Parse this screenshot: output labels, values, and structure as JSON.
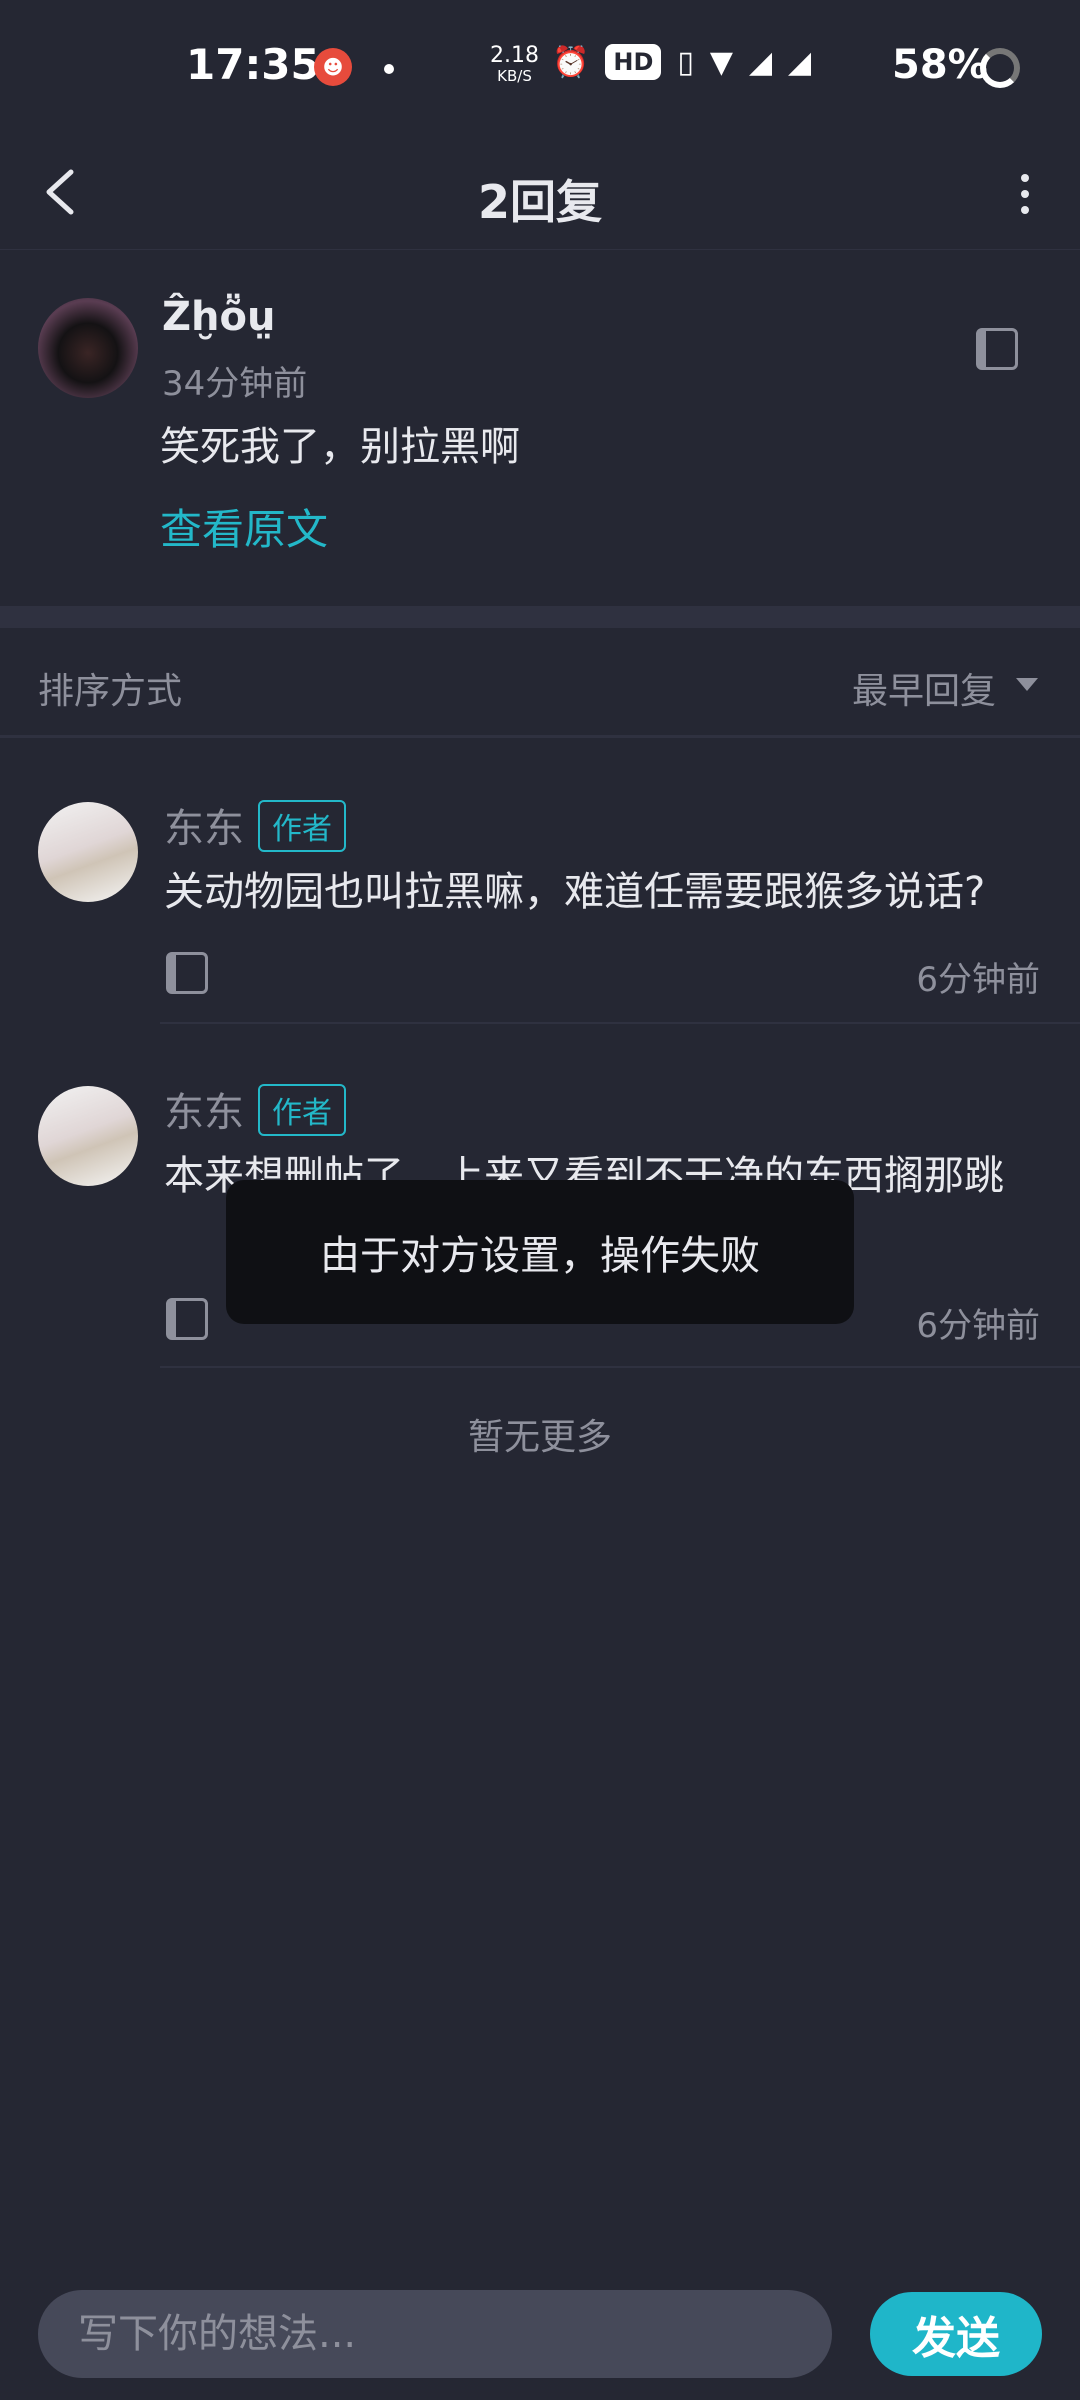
{
  "status_bar": {
    "time": "17:35",
    "net_speed": "2.18",
    "net_unit": "KB/S",
    "hd_badge": "HD",
    "battery": "58%"
  },
  "header": {
    "title": "2回复"
  },
  "post": {
    "author": "Ẑḫṏṳ",
    "time": "34分钟前",
    "text": "笑死我了，别拉黑啊",
    "view_original": "查看原文"
  },
  "sort": {
    "label": "排序方式",
    "value": "最早回复"
  },
  "replies": [
    {
      "author": "东东",
      "tag": "作者",
      "text": "关动物园也叫拉黑嘛，难道任需要跟猴多说话?",
      "time": "6分钟前"
    },
    {
      "author": "东东",
      "tag": "作者",
      "text": "本来想删帖了，上来又看到不干净的东西搁那跳",
      "time": "6分钟前"
    }
  ],
  "no_more": "暂无更多",
  "toast": "由于对方设置，操作失败",
  "input": {
    "placeholder": "写下你的想法...",
    "send_label": "发送"
  },
  "colors": {
    "background": "#252733",
    "accent": "#23b8c9",
    "muted": "#8e909c"
  }
}
